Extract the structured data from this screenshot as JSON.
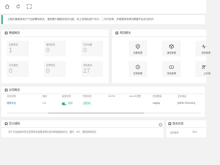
{
  "topbar": {
    "icons": [
      "home-icon",
      "refresh-icon",
      "expand-icon"
    ]
  },
  "notice": {
    "text": "云服务器推荐用于产品部署和测试，请按需开通服务相关功能，防止非授权用户访问，二次开发请，并根据具体情况需要开启安全防护。"
  },
  "data_overview": {
    "title": "数据概览",
    "stats": [
      {
        "label": "设备数量",
        "value": "1"
      },
      {
        "label": "通道数量",
        "value": "0"
      },
      {
        "label": "在线设备",
        "value": "0"
      },
      {
        "label": "在线通道",
        "value": "0"
      },
      {
        "label": "告警数量",
        "value": "0"
      },
      {
        "label": "录像数量",
        "value": "27"
      }
    ]
  },
  "tools": {
    "title": "常用模块",
    "items": [
      {
        "label": "设备管理",
        "icon": "shield-icon"
      },
      {
        "label": "通道管理",
        "icon": "cube-icon"
      },
      {
        "label": "录像管理",
        "icon": "pulse-icon"
      },
      {
        "label": "告警管理",
        "icon": "clock-icon"
      },
      {
        "label": "录像管理",
        "icon": "video-icon"
      },
      {
        "label": "云存储",
        "icon": "users-icon"
      }
    ]
  },
  "app_panel": {
    "title": "应用概览",
    "columns": [
      "应用名称",
      "版本",
      "运营状态",
      "开放状态",
      "AK/SK",
      "sub AK类型",
      "在线数量",
      "主机地址"
    ],
    "rows": [
      {
        "name": "视频平台",
        "version": "1.0",
        "status": "启用",
        "open": "运行中",
        "ak": "",
        "sub_ak": "",
        "online": "ring/tsp",
        "host": "[IMPB-7E25-5G1]"
      }
    ]
  },
  "announcement": {
    "title": "官方通知",
    "text": "关于平台使用中的注意事项请查看说明文档中获取最新资讯，插件、API、授权说明情况。"
  },
  "system_info": {
    "title": "版本信息",
    "label": "当前版本",
    "value": "V3.1"
  },
  "colors": {
    "accent": "#2ab47f",
    "stat_value": "#a8b7c7"
  }
}
